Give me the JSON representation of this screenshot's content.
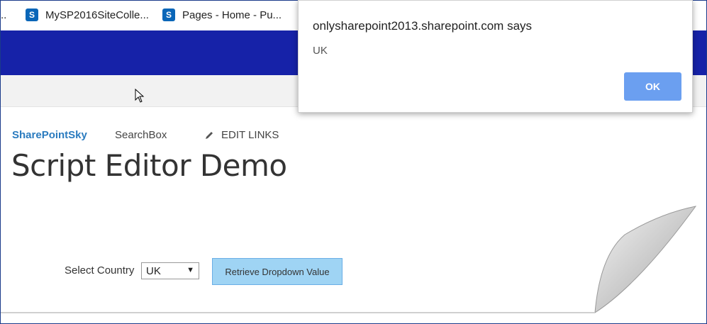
{
  "bookmarks": {
    "dots": "..",
    "items": [
      {
        "label": "MySP2016SiteColle...",
        "icon": "sharepoint-icon"
      },
      {
        "label": "Pages - Home - Pu...",
        "icon": "sharepoint-icon"
      }
    ]
  },
  "colors": {
    "suitebar": "#1622a8",
    "link": "#2a7bbf",
    "button_bg": "#9fd4f4",
    "ok_button": "#6b9ff0"
  },
  "nav": {
    "home": "SharePointSky",
    "search": "SearchBox",
    "edit_links": "EDIT LINKS",
    "edit_icon": "pencil-icon"
  },
  "page": {
    "title": "Script Editor Demo"
  },
  "form": {
    "select_label": "Select Country",
    "selected_value": "UK",
    "retrieve_button": "Retrieve Dropdown Value"
  },
  "alert": {
    "title": "onlysharepoint2013.sharepoint.com says",
    "message": "UK",
    "ok_label": "OK"
  }
}
